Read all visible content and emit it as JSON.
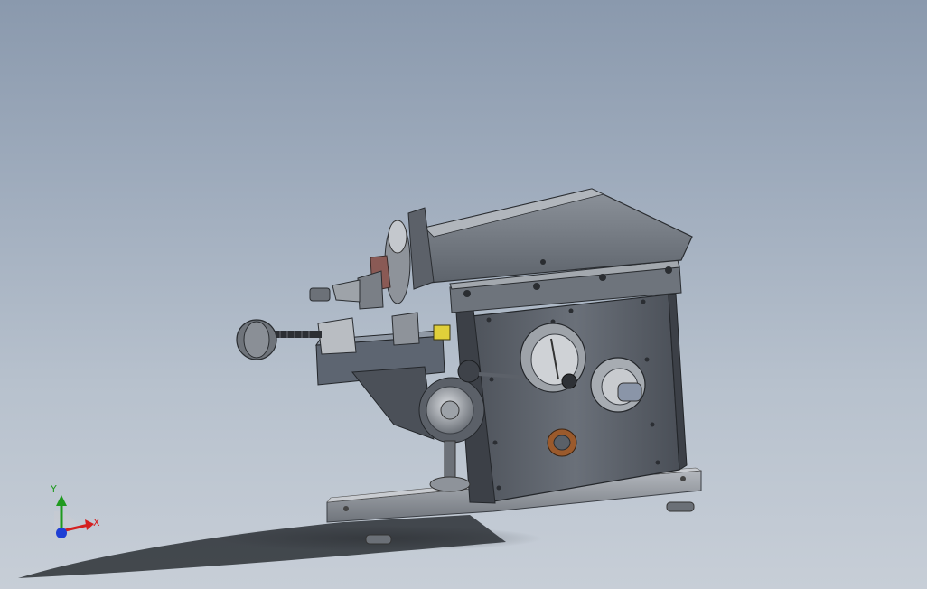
{
  "viewport": {
    "background_top": "#8a99ad",
    "background_bottom": "#c7ced7"
  },
  "model": {
    "icon": "cad-machine-assembly-icon"
  },
  "triad": {
    "icon": "coordinate-triad-icon",
    "x_label": "X",
    "y_label": "Y",
    "x_color": "#d41f1f",
    "y_color": "#1f9a1f",
    "z_color": "#1f3fd4"
  }
}
